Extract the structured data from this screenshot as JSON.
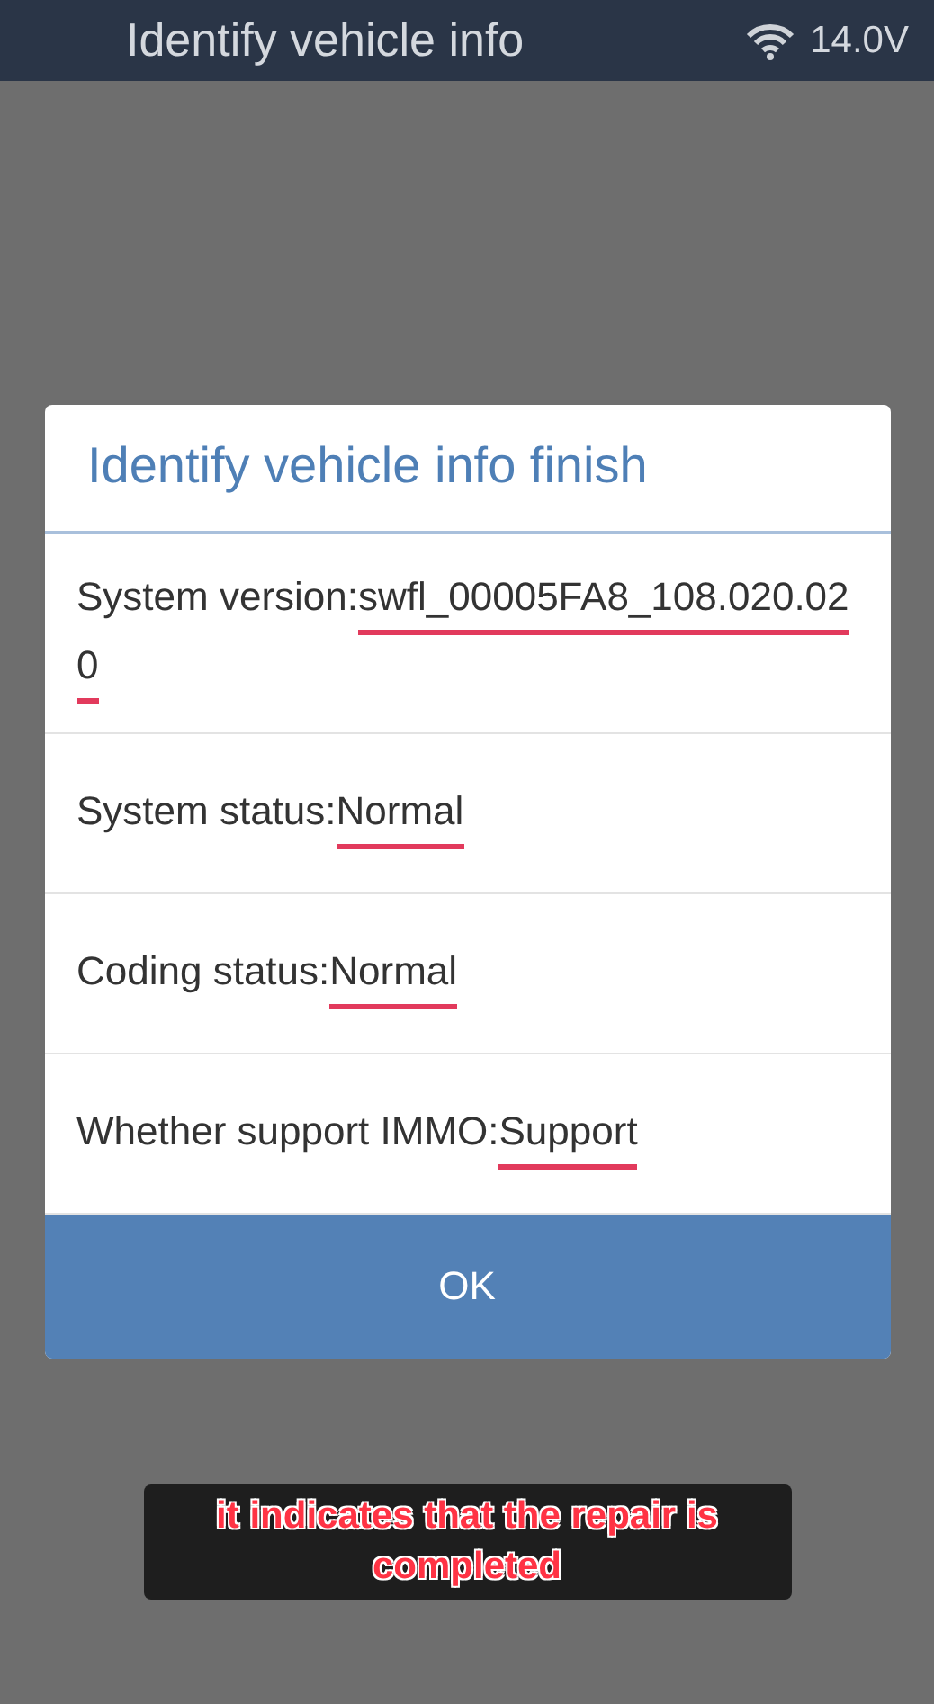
{
  "top_bar": {
    "title": "Identify vehicle info",
    "voltage": "14.0V"
  },
  "dialog": {
    "title": "Identify vehicle info finish",
    "rows": [
      {
        "label": "System version:",
        "value": "swfl_00005FA8_108.020.020",
        "underlined": true
      },
      {
        "label": "System status:",
        "value": "Normal",
        "underlined": true
      },
      {
        "label": "Coding status:",
        "value": "Normal",
        "underlined": true
      },
      {
        "label": "Whether support IMMO:",
        "value": "Support",
        "underlined": true
      }
    ],
    "button": "OK"
  },
  "caption": "it indicates that the repair is completed"
}
